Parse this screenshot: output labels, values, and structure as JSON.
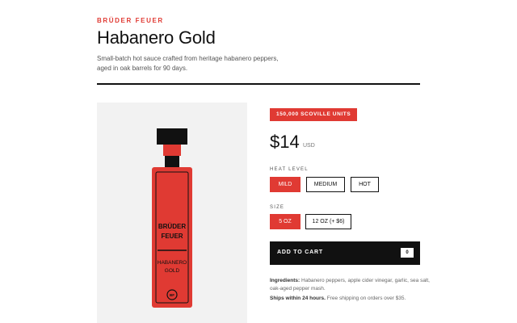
{
  "product": {
    "brand": "BRÜDER FEUER",
    "title": "Habanero Gold",
    "description": "Small-batch hot sauce crafted from heritage habanero peppers, aged in oak barrels for 90 days."
  },
  "bottle_label": {
    "brand_line1": "BRÜDER",
    "brand_line2": "FEUER",
    "variety_line1": "HABANERO",
    "variety_line2": "GOLD",
    "seal": "BF"
  },
  "colors": {
    "accent": "#e03a33",
    "ink": "#111111",
    "media_background": "#f2f2f2"
  },
  "badge": "150,000 SCOVILLE UNITS",
  "pricing": {
    "price": "$14",
    "currency": "USD"
  },
  "heat": {
    "label": "HEAT LEVEL",
    "options": [
      "MILD",
      "MEDIUM",
      "HOT"
    ],
    "selected": "MILD"
  },
  "size": {
    "label": "SIZE",
    "options": [
      "5 OZ",
      "12 OZ (+ $6)"
    ],
    "selected": "5 OZ"
  },
  "cart": {
    "label": "ADD TO CART",
    "count": "0"
  },
  "details": {
    "ingredients_label": "Ingredients:",
    "ingredients_text": " Habanero peppers, apple cider vinegar, garlic, sea salt, oak-aged pepper mash.",
    "shipping_label": "Ships within 24 hours.",
    "shipping_text": " Free shipping on orders over $35."
  }
}
